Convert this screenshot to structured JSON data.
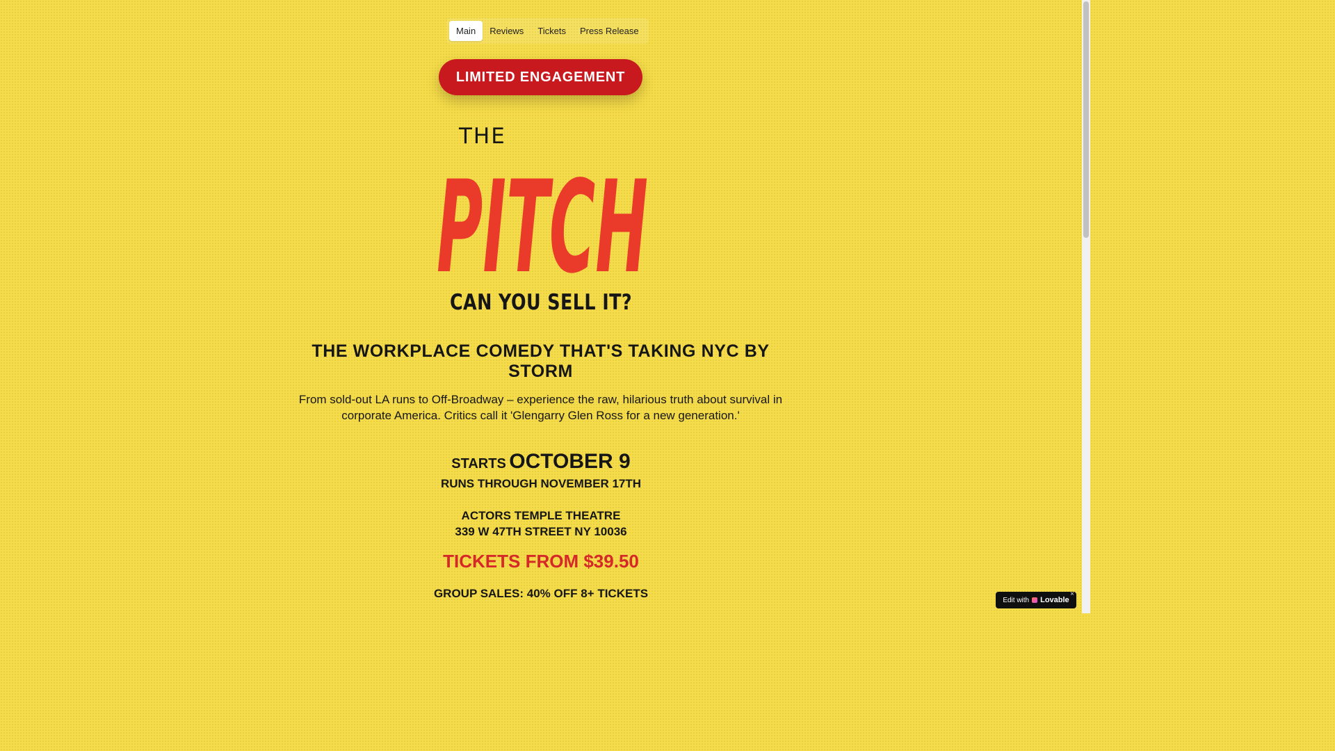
{
  "nav": {
    "tabs": [
      {
        "label": "Main",
        "active": true
      },
      {
        "label": "Reviews",
        "active": false
      },
      {
        "label": "Tickets",
        "active": false
      },
      {
        "label": "Press Release",
        "active": false
      }
    ]
  },
  "badge": {
    "label": "LIMITED ENGAGEMENT"
  },
  "logo": {
    "line1": "THE",
    "line2": "PITCH"
  },
  "hero": {
    "tagline": "CAN YOU SELL IT?",
    "headline": "THE WORKPLACE COMEDY THAT'S TAKING NYC BY STORM",
    "description": "From sold-out LA runs to Off-Broadway – experience the raw, hilarious truth about survival in corporate America. Critics call it 'Glengarry Glen Ross for a new generation.'"
  },
  "schedule": {
    "starts_label": "STARTS",
    "start_date": "OCTOBER 9",
    "runs_through": "RUNS THROUGH NOVEMBER 17TH"
  },
  "venue": {
    "name": "ACTORS TEMPLE THEATRE",
    "address": "339 W 47TH STREET NY 10036"
  },
  "pricing": {
    "tickets_from": "TICKETS FROM $39.50",
    "group_sales": "GROUP SALES: 40% OFF 8+ TICKETS"
  },
  "lovable_badge": {
    "prefix": "Edit with",
    "brand": "Lovable",
    "close": "×"
  },
  "colors": {
    "background": "#f5dc4a",
    "accent_red": "#c8191e",
    "logo_red": "#ea3a2a",
    "text": "#161616"
  }
}
